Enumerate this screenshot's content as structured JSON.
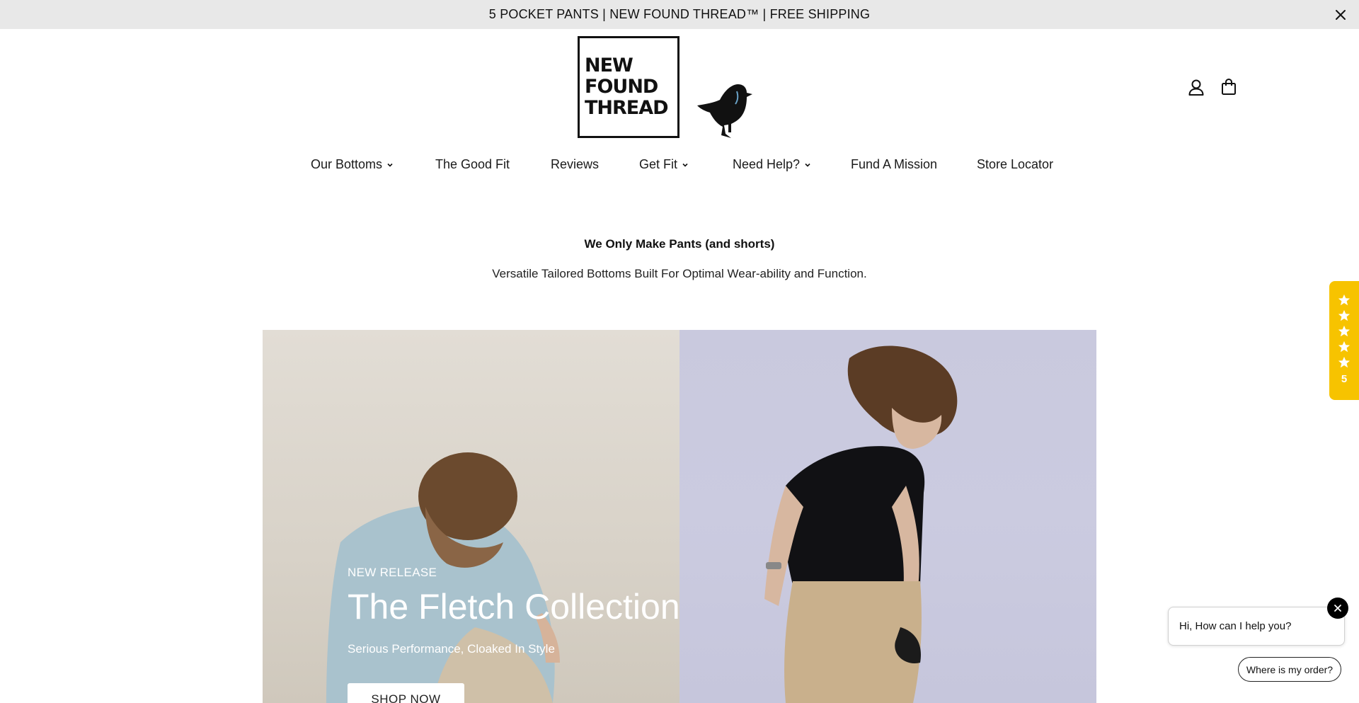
{
  "announcement": {
    "text": "5 POCKET PANTS | NEW FOUND THREAD™ | FREE SHIPPING",
    "close_icon": "close-icon"
  },
  "header": {
    "logo_lines": [
      "NEW",
      "FOUND",
      "THREAD"
    ],
    "logo_bird_icon": "crow-icon",
    "account_icon": "user-icon",
    "cart_icon": "shopping-bag-icon"
  },
  "nav": {
    "items": [
      {
        "label": "Our Bottoms",
        "has_dropdown": true
      },
      {
        "label": "The Good Fit",
        "has_dropdown": false
      },
      {
        "label": "Reviews",
        "has_dropdown": false
      },
      {
        "label": "Get Fit",
        "has_dropdown": true
      },
      {
        "label": "Need Help?",
        "has_dropdown": true
      },
      {
        "label": "Fund A Mission",
        "has_dropdown": false
      },
      {
        "label": "Store Locator",
        "has_dropdown": false
      }
    ]
  },
  "intro": {
    "title": "We Only Make Pants (and shorts)",
    "subtitle": "Versatile Tailored Bottoms Built For Optimal Wear-ability and Function."
  },
  "hero": {
    "eyebrow": "NEW RELEASE",
    "title": "The Fletch Collection",
    "subtitle": "Serious Performance, Cloaked In Style",
    "cta_label": "SHOP NOW"
  },
  "reviews_tab": {
    "star_icon": "star-icon",
    "stars": 5,
    "count": "5",
    "accent": "#f7c300"
  },
  "chat": {
    "greeting": "Hi, How can I help you?",
    "quick_reply": "Where is my order?",
    "close_icon": "close-icon"
  }
}
